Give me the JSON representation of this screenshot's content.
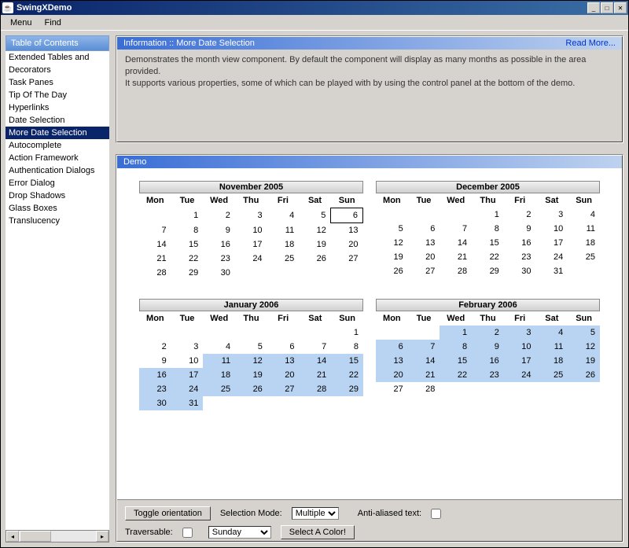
{
  "window": {
    "title": "SwingXDemo"
  },
  "menu": {
    "item0": "Menu",
    "item1": "Find"
  },
  "sidebar": {
    "header": "Table of Contents",
    "items": [
      "Extended Tables and",
      "Decorators",
      "Task Panes",
      "Tip Of The Day",
      "Hyperlinks",
      "Date Selection",
      "More Date Selection",
      "Autocomplete",
      "Action Framework",
      "Authentication Dialogs",
      "Error Dialog",
      "Drop Shadows",
      "Glass Boxes",
      "Translucency"
    ],
    "selected_index": 6
  },
  "info": {
    "header": "Information :: More Date Selection",
    "readmore": "Read More...",
    "line1": "Demonstrates the month view component. By default the component will display as many months as possible in the area provided.",
    "line2": "It supports various properties, some of which can be played with by using the control panel at the bottom of the demo."
  },
  "demo": {
    "header": "Demo"
  },
  "dow": [
    "Mon",
    "Tue",
    "Wed",
    "Thu",
    "Fri",
    "Sat",
    "Sun"
  ],
  "months": {
    "nov": {
      "title": "November 2005"
    },
    "dec": {
      "title": "December 2005"
    },
    "jan": {
      "title": "January 2006"
    },
    "feb": {
      "title": "February 2006"
    }
  },
  "controls": {
    "toggle": "Toggle orientation",
    "selmode_label": "Selection Mode:",
    "selmode_value": "Multiple",
    "antialias_label": "Anti-aliased text:",
    "traversable_label": "Traversable:",
    "day_value": "Sunday",
    "color_btn": "Select A Color!"
  }
}
